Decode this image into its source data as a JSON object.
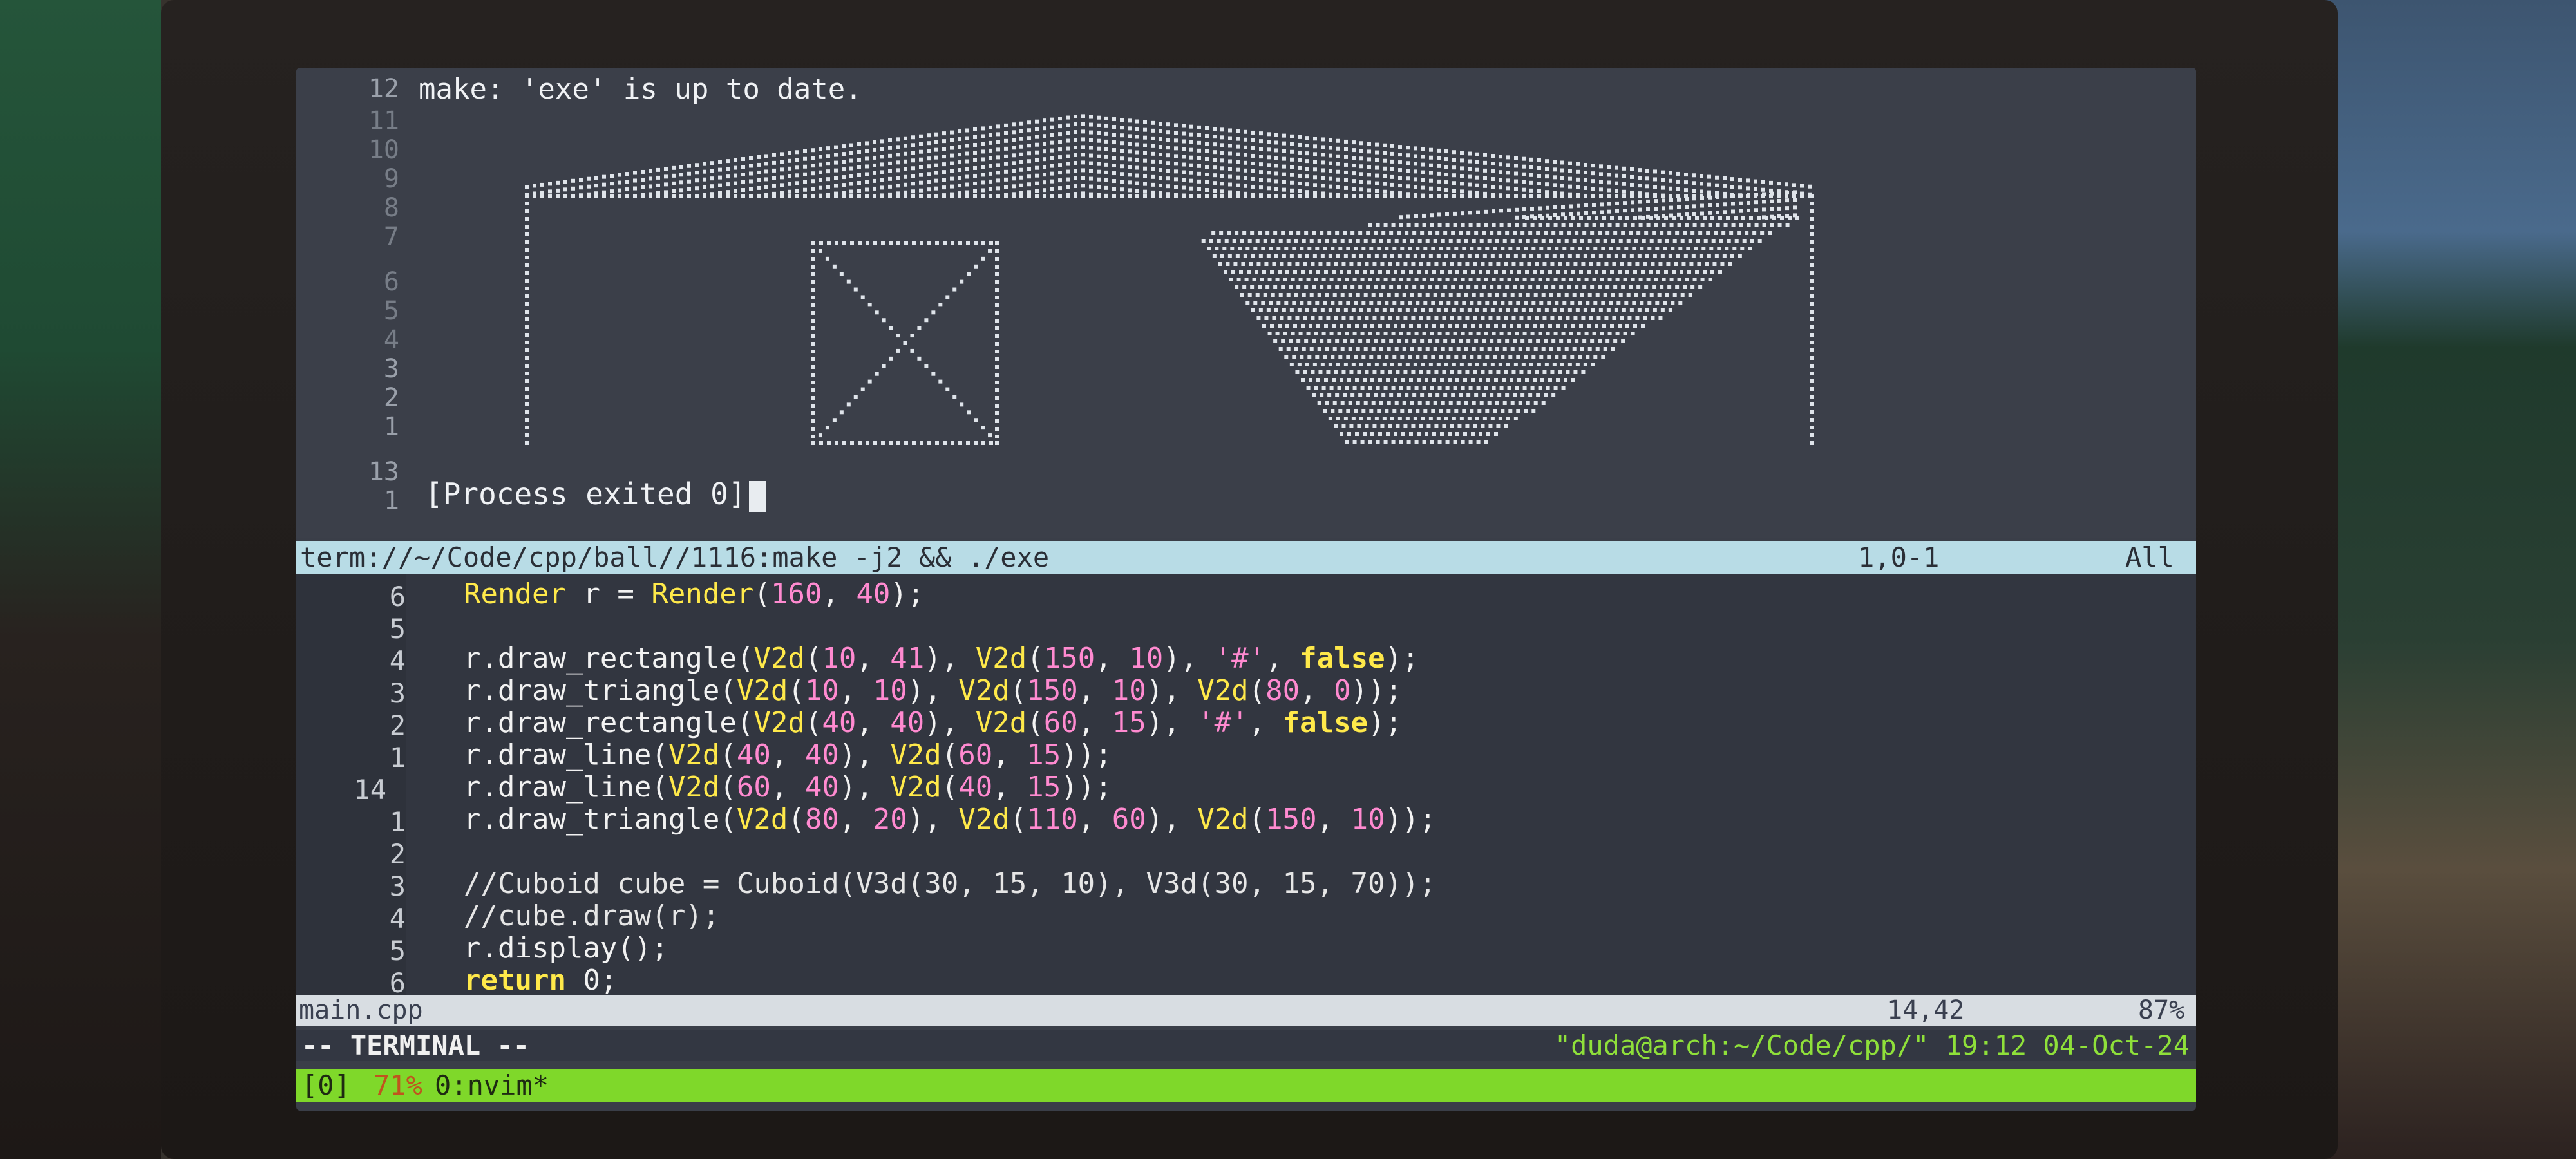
{
  "top_pane": {
    "gutter_numbers": [
      "12",
      "11",
      "10",
      "9",
      "8",
      "7",
      "6",
      "5",
      "4",
      "3",
      "2",
      "1",
      "13",
      "1"
    ],
    "make_output": "make: 'exe' is up to date.",
    "process_exit": "[Process exited 0]",
    "status": {
      "path": "term://~/Code/cpp/ball//1116:make -j2 && ./exe",
      "position": "1,0-1",
      "scroll": "All"
    }
  },
  "code_pane": {
    "line_numbers": [
      "6",
      "5",
      "4",
      "3",
      "2",
      "1",
      "14",
      "1",
      "2",
      "3",
      "4",
      "5",
      "6"
    ],
    "lines": [
      "Render r = Render(160, 40);",
      "",
      "r.draw_rectangle(V2d(10, 41), V2d(150, 10), '#', false);",
      "r.draw_triangle(V2d(10, 10), V2d(150, 10), V2d(80, 0));",
      "r.draw_rectangle(V2d(40, 40), V2d(60, 15), '#', false);",
      "r.draw_line(V2d(40, 40), V2d(60, 15));",
      "r.draw_line(V2d(60, 40), V2d(40, 15));",
      "r.draw_triangle(V2d(80, 20), V2d(110, 60), V2d(150, 10));",
      "",
      "//Cuboid cube = Cuboid(V3d(30, 15, 10), V3d(30, 15, 70));",
      "//cube.draw(r);",
      "r.display();",
      "return 0;"
    ],
    "status": {
      "filename": "main.cpp",
      "position": "14,42",
      "scroll": "87%"
    }
  },
  "mode_line": "-- TERMINAL --",
  "tmux": {
    "session": "[0]",
    "window_index": "71%",
    "window": "0:nvim*",
    "right": "\"duda@arch:~/Code/cpp/\" 19:12 04-Oct-24"
  },
  "colors": {
    "terminal_bg": "#3b3f49",
    "status_bar": "#b8dce6",
    "tmux_bar": "#7fd82a",
    "keyword": "#ffe94a",
    "number": "#ff8ad0"
  }
}
